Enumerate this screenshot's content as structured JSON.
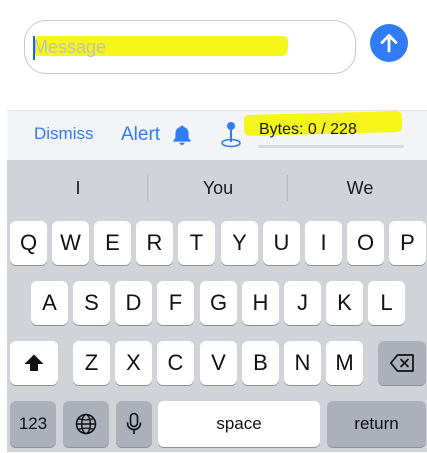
{
  "compose": {
    "placeholder": "Message",
    "send_icon": "arrow-up-icon",
    "accent_color": "#2f7cf6"
  },
  "accessory_bar": {
    "dismiss_label": "Dismiss",
    "alert_label": "Alert",
    "alert_icon": "bell-icon",
    "pin_icon": "map-pin-icon",
    "bytes_label": "Bytes: 0 / 228",
    "bytes_used_fraction": 0
  },
  "suggestions": [
    "I",
    "You",
    "We"
  ],
  "keyboard": {
    "row1": [
      "Q",
      "W",
      "E",
      "R",
      "T",
      "Y",
      "U",
      "I",
      "O",
      "P"
    ],
    "row2": [
      "A",
      "S",
      "D",
      "F",
      "G",
      "H",
      "J",
      "K",
      "L"
    ],
    "row3": [
      "Z",
      "X",
      "C",
      "V",
      "B",
      "N",
      "M"
    ],
    "numbers_label": "123",
    "space_label": "space",
    "return_label": "return",
    "shift_icon": "shift-icon",
    "backspace_icon": "backspace-icon",
    "globe_icon": "globe-icon",
    "mic_icon": "microphone-icon"
  }
}
